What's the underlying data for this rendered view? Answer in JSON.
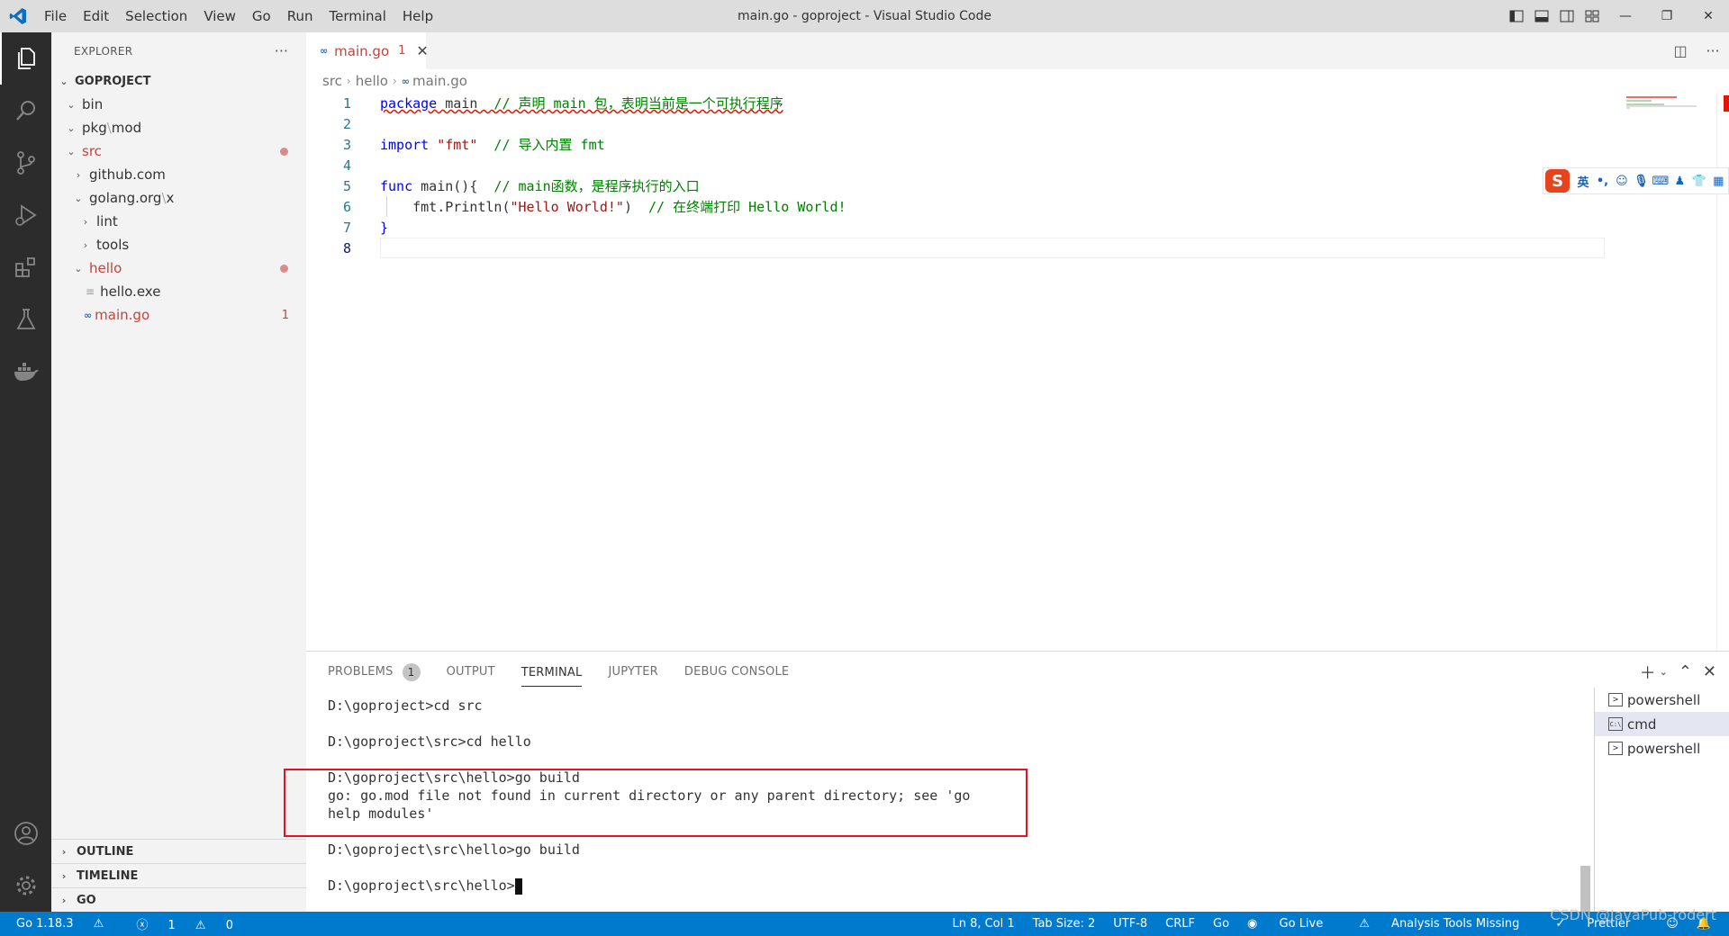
{
  "window": {
    "title": "main.go - goproject - Visual Studio Code",
    "menu": [
      "File",
      "Edit",
      "Selection",
      "View",
      "Go",
      "Run",
      "Terminal",
      "Help"
    ]
  },
  "sidebar": {
    "title": "EXPLORER",
    "more": "···",
    "project": "GOPROJECT",
    "tree": [
      {
        "label": "bin",
        "depth": 1,
        "expanded": true
      },
      {
        "label": "pkg",
        "label2": "mod",
        "depth": 1,
        "expanded": true
      },
      {
        "label": "src",
        "depth": 1,
        "expanded": true,
        "modified": true
      },
      {
        "label": "github.com",
        "depth": 2,
        "expanded": false
      },
      {
        "label": "golang.org",
        "label2": "x",
        "depth": 2,
        "expanded": true
      },
      {
        "label": "lint",
        "depth": 3,
        "expanded": false
      },
      {
        "label": "tools",
        "depth": 3,
        "expanded": false
      },
      {
        "label": "hello",
        "depth": 2,
        "expanded": true,
        "modified": true
      },
      {
        "label": "hello.exe",
        "depth": 3
      },
      {
        "label": "main.go",
        "depth": 3,
        "problems": "1"
      }
    ],
    "sections": [
      "OUTLINE",
      "TIMELINE",
      "GO"
    ]
  },
  "editor": {
    "tab": {
      "label": "main.go",
      "problems": "1"
    },
    "breadcrumb": [
      "src",
      "hello",
      "main.go"
    ],
    "line_numbers": [
      "1",
      "2",
      "3",
      "4",
      "5",
      "6",
      "7",
      "8"
    ],
    "code": {
      "l1_kw": "package",
      "l1_name": " main",
      "l1_cm": "  // 声明 main 包，表明当前是一个可执行程序",
      "l3_kw": "import",
      "l3_str": " \"fmt\"",
      "l3_cm": "  // 导入内置 fmt",
      "l5_kw": "func",
      "l5_rest": " main(){",
      "l5_cm": "  // main函数，是程序执行的入口",
      "l6_pre": "    fmt.Println(",
      "l6_str": "\"Hello World!\"",
      "l6_post": ")",
      "l6_cm": "  // 在终端打印 Hello World!",
      "l7": "}"
    }
  },
  "ime": {
    "lang": "英",
    "punct": "•,"
  },
  "panel": {
    "tabs": [
      "PROBLEMS",
      "OUTPUT",
      "TERMINAL",
      "JUPYTER",
      "DEBUG CONSOLE"
    ],
    "problems_count": "1",
    "active_tab": "TERMINAL",
    "terminal_lines": [
      "D:\\goproject>cd src",
      "",
      "D:\\goproject\\src>cd hello",
      "",
      "D:\\goproject\\src\\hello>go build",
      "go: go.mod file not found in current directory or any parent directory; see 'go",
      "help modules'",
      "",
      "D:\\goproject\\src\\hello>go build",
      "",
      "D:\\goproject\\src\\hello>"
    ],
    "terminals": [
      {
        "label": "powershell",
        "icon": ">"
      },
      {
        "label": "cmd",
        "icon": "C:\\"
      },
      {
        "label": "powershell",
        "icon": ">"
      }
    ]
  },
  "statusbar": {
    "go_version": "Go 1.18.3",
    "errors": "1",
    "warnings": "0",
    "right": [
      "Ln 8, Col 1",
      "Tab Size: 2",
      "UTF-8",
      "CRLF",
      "Go",
      "Go Live",
      "Analysis Tools Missing",
      "Prettier"
    ]
  },
  "watermark": "CSDN @JavaPub-rodert",
  "colors": {
    "accent": "#007acc",
    "error": "#e51400",
    "highlight_box": "#e81123"
  }
}
